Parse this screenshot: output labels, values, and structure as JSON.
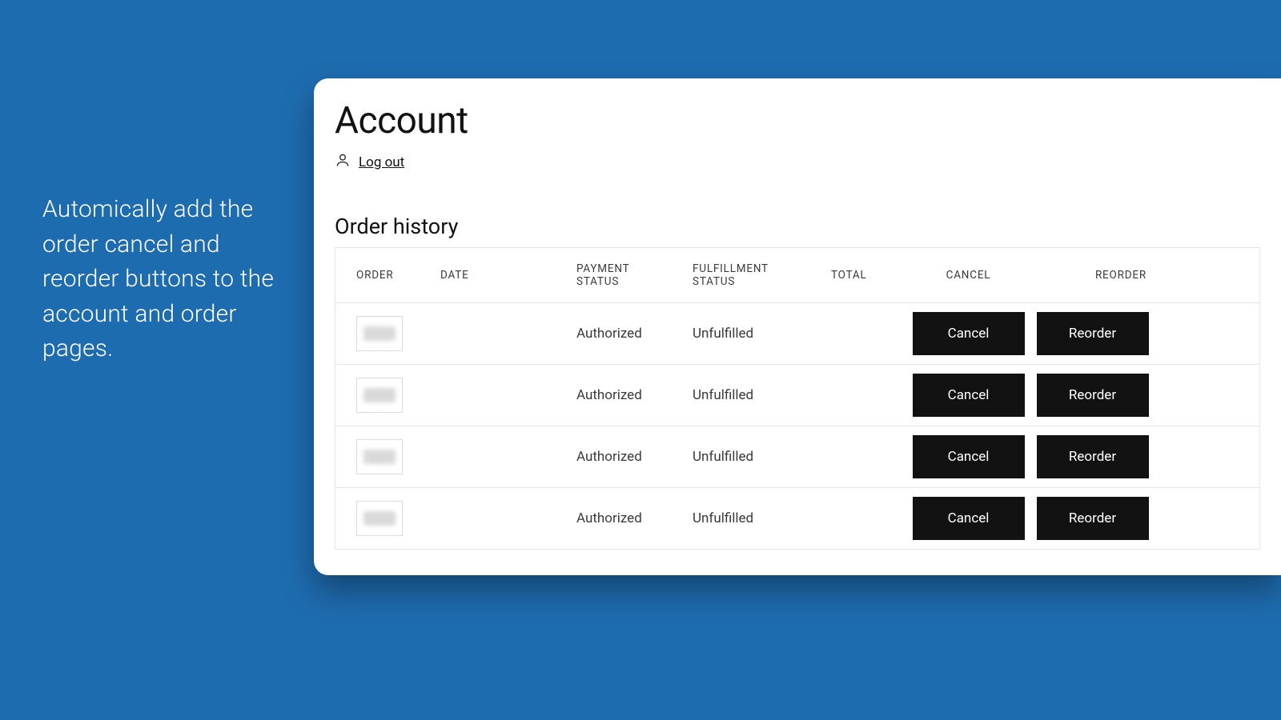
{
  "caption": "Automically add the order cancel and reorder buttons to the account and order pages.",
  "page": {
    "title": "Account",
    "logout_label": "Log out",
    "history_title": "Order history"
  },
  "table": {
    "headers": {
      "order": "ORDER",
      "date": "DATE",
      "payment_status": "PAYMENT STATUS",
      "fulfillment_status": "FULFILLMENT STATUS",
      "total": "TOTAL",
      "cancel": "CANCEL",
      "reorder": "REORDER"
    },
    "rows": [
      {
        "payment_status": "Authorized",
        "fulfillment_status": "Unfulfilled",
        "cancel_label": "Cancel",
        "reorder_label": "Reorder"
      },
      {
        "payment_status": "Authorized",
        "fulfillment_status": "Unfulfilled",
        "cancel_label": "Cancel",
        "reorder_label": "Reorder"
      },
      {
        "payment_status": "Authorized",
        "fulfillment_status": "Unfulfilled",
        "cancel_label": "Cancel",
        "reorder_label": "Reorder"
      },
      {
        "payment_status": "Authorized",
        "fulfillment_status": "Unfulfilled",
        "cancel_label": "Cancel",
        "reorder_label": "Reorder"
      }
    ]
  }
}
